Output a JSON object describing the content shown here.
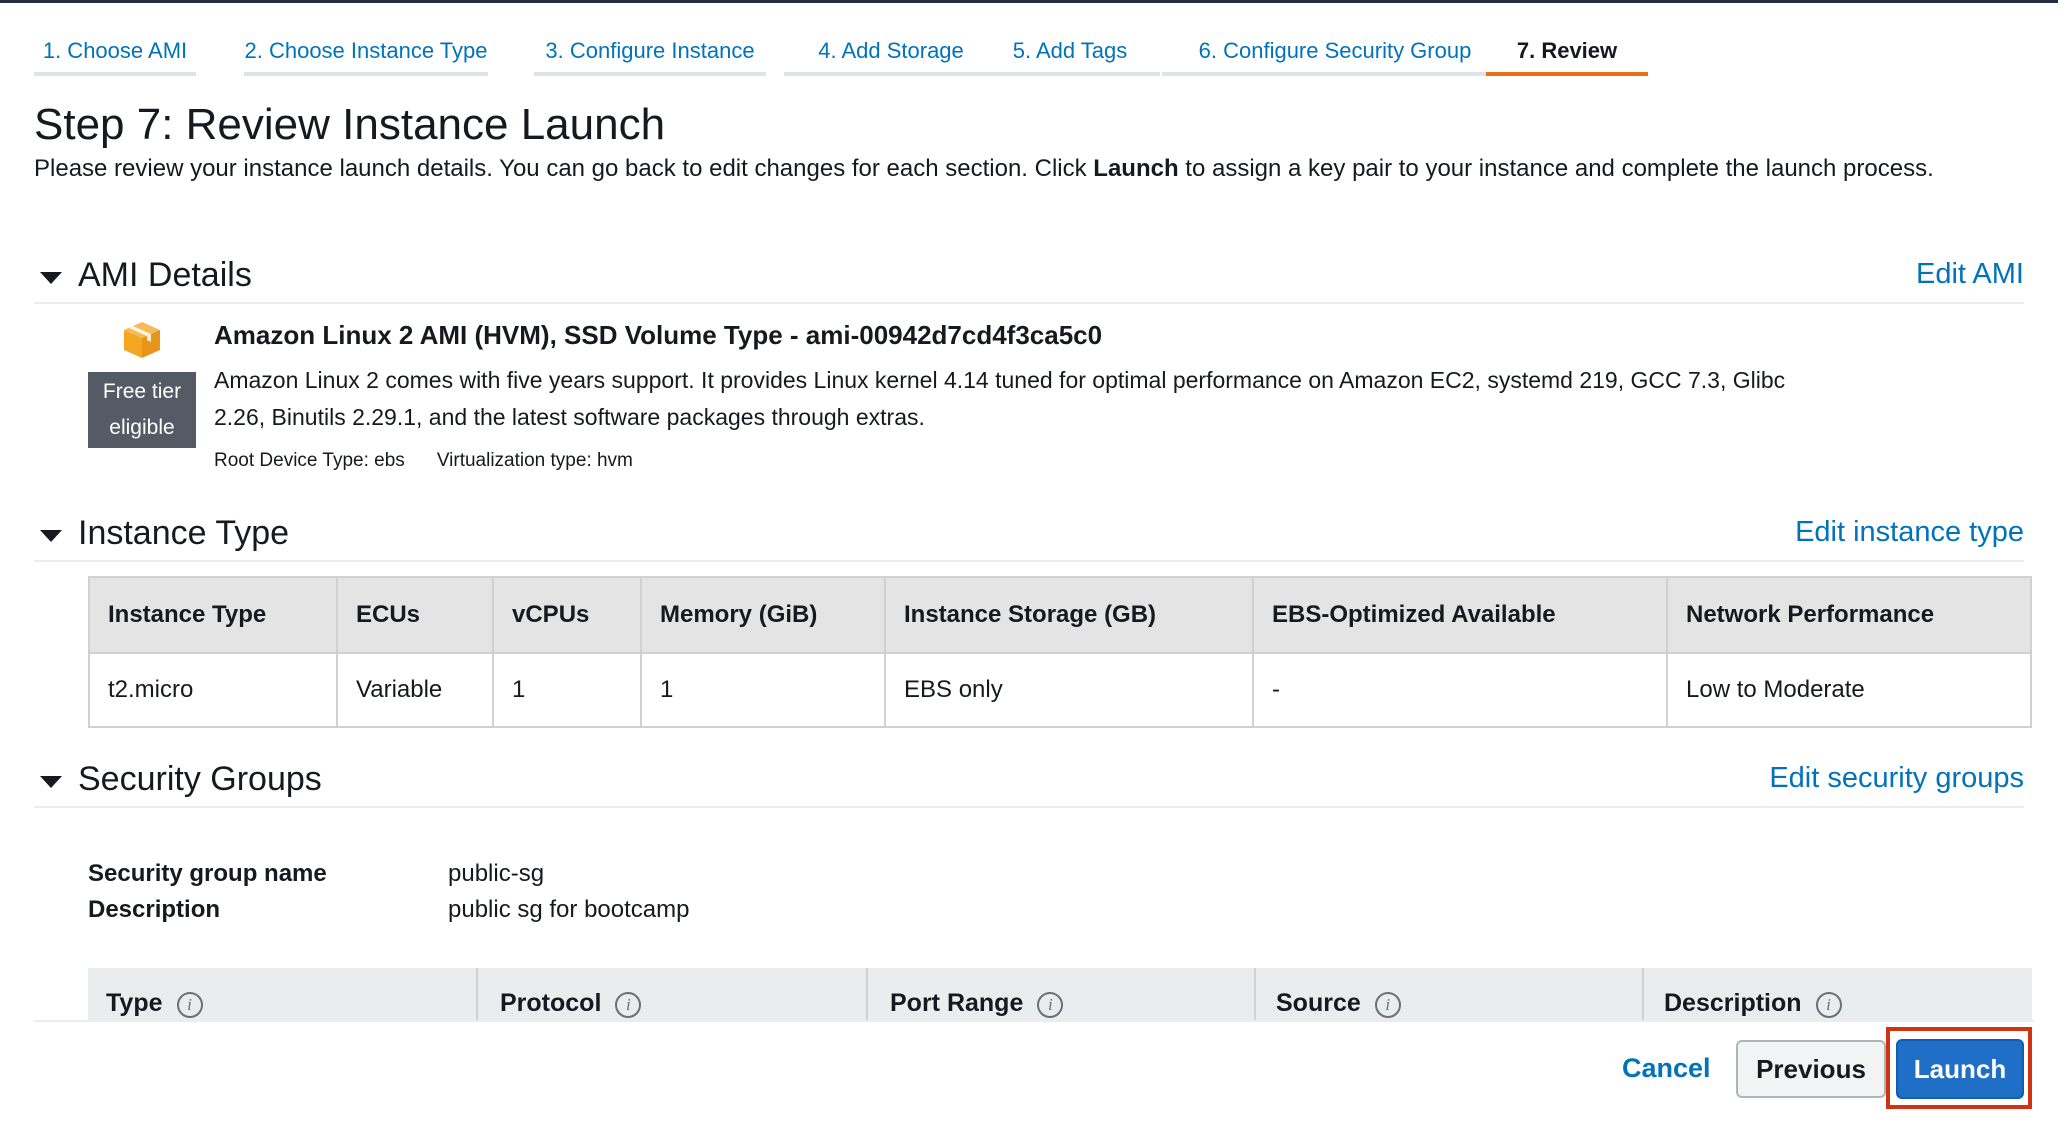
{
  "colors": {
    "link": "#0073bb",
    "active_tab_underline": "#ec7211",
    "primary_button": "#1f6fc6",
    "highlight_border": "#d13212",
    "free_tier_badge": "#545b64",
    "ami_icon": "#f5a623"
  },
  "tabs": [
    {
      "label": "1. Choose AMI",
      "active": false
    },
    {
      "label": "2. Choose Instance Type",
      "active": false
    },
    {
      "label": "3. Configure Instance",
      "active": false
    },
    {
      "label": "4. Add Storage",
      "active": false
    },
    {
      "label": "5. Add Tags",
      "active": false
    },
    {
      "label": "6. Configure Security Group",
      "active": false
    },
    {
      "label": "7. Review",
      "active": true
    }
  ],
  "page": {
    "title": "Step 7: Review Instance Launch",
    "intro_before": "Please review your instance launch details. You can go back to edit changes for each section. Click ",
    "intro_bold": "Launch",
    "intro_after": " to assign a key pair to your instance and complete the launch process."
  },
  "ami_section": {
    "title": "AMI Details",
    "edit_label": "Edit AMI",
    "icon": "package-box-icon",
    "badge_line1": "Free tier",
    "badge_line2": "eligible",
    "name": "Amazon Linux 2 AMI (HVM), SSD Volume Type - ami-00942d7cd4f3ca5c0",
    "description": "Amazon Linux 2 comes with five years support. It provides Linux kernel 4.14 tuned for optimal performance on Amazon EC2, systemd 219, GCC 7.3, Glibc 2.26, Binutils 2.29.1, and the latest software packages through extras.",
    "root_device": "Root Device Type: ebs",
    "virtualization": "Virtualization type: hvm"
  },
  "instance_section": {
    "title": "Instance Type",
    "edit_label": "Edit instance type",
    "columns": [
      "Instance Type",
      "ECUs",
      "vCPUs",
      "Memory (GiB)",
      "Instance Storage (GB)",
      "EBS-Optimized Available",
      "Network Performance"
    ],
    "rows": [
      [
        "t2.micro",
        "Variable",
        "1",
        "1",
        "EBS only",
        "-",
        "Low to Moderate"
      ]
    ]
  },
  "security_section": {
    "title": "Security Groups",
    "edit_label": "Edit security groups",
    "name_label": "Security group name",
    "name_value": "public-sg",
    "desc_label": "Description",
    "desc_value": "public sg for bootcamp",
    "rule_columns": [
      "Type",
      "Protocol",
      "Port Range",
      "Source",
      "Description"
    ],
    "info_glyph": "i"
  },
  "footer": {
    "cancel_label": "Cancel",
    "previous_label": "Previous",
    "launch_label": "Launch"
  }
}
